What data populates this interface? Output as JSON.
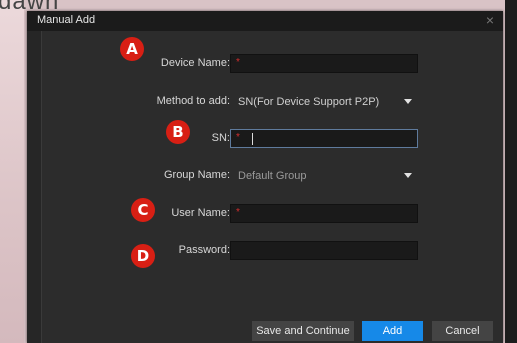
{
  "background": {
    "partial_text": "dawn"
  },
  "dialog": {
    "title": "Manual Add",
    "close_symbol": "×",
    "fields": {
      "device_name": {
        "label": "Device Name:",
        "value": "",
        "required_mark": "*"
      },
      "method": {
        "label": "Method to add:",
        "value": "SN(For Device Support P2P)"
      },
      "sn": {
        "label": "SN:",
        "value": "",
        "required_mark": "*"
      },
      "group_name": {
        "label": "Group Name:",
        "value": "Default Group"
      },
      "user_name": {
        "label": "User Name:",
        "value": "",
        "required_mark": "*"
      },
      "password": {
        "label": "Password:",
        "value": ""
      }
    },
    "buttons": {
      "save_continue": "Save and Continue",
      "add": "Add",
      "cancel": "Cancel"
    }
  },
  "annotations": {
    "a": "A",
    "b": "B",
    "c": "C",
    "d": "D"
  },
  "colors": {
    "accent": "#1689e8",
    "marker": "#d81f14",
    "required": "#d52f2f",
    "dialog_bg": "#2c2c2c"
  }
}
